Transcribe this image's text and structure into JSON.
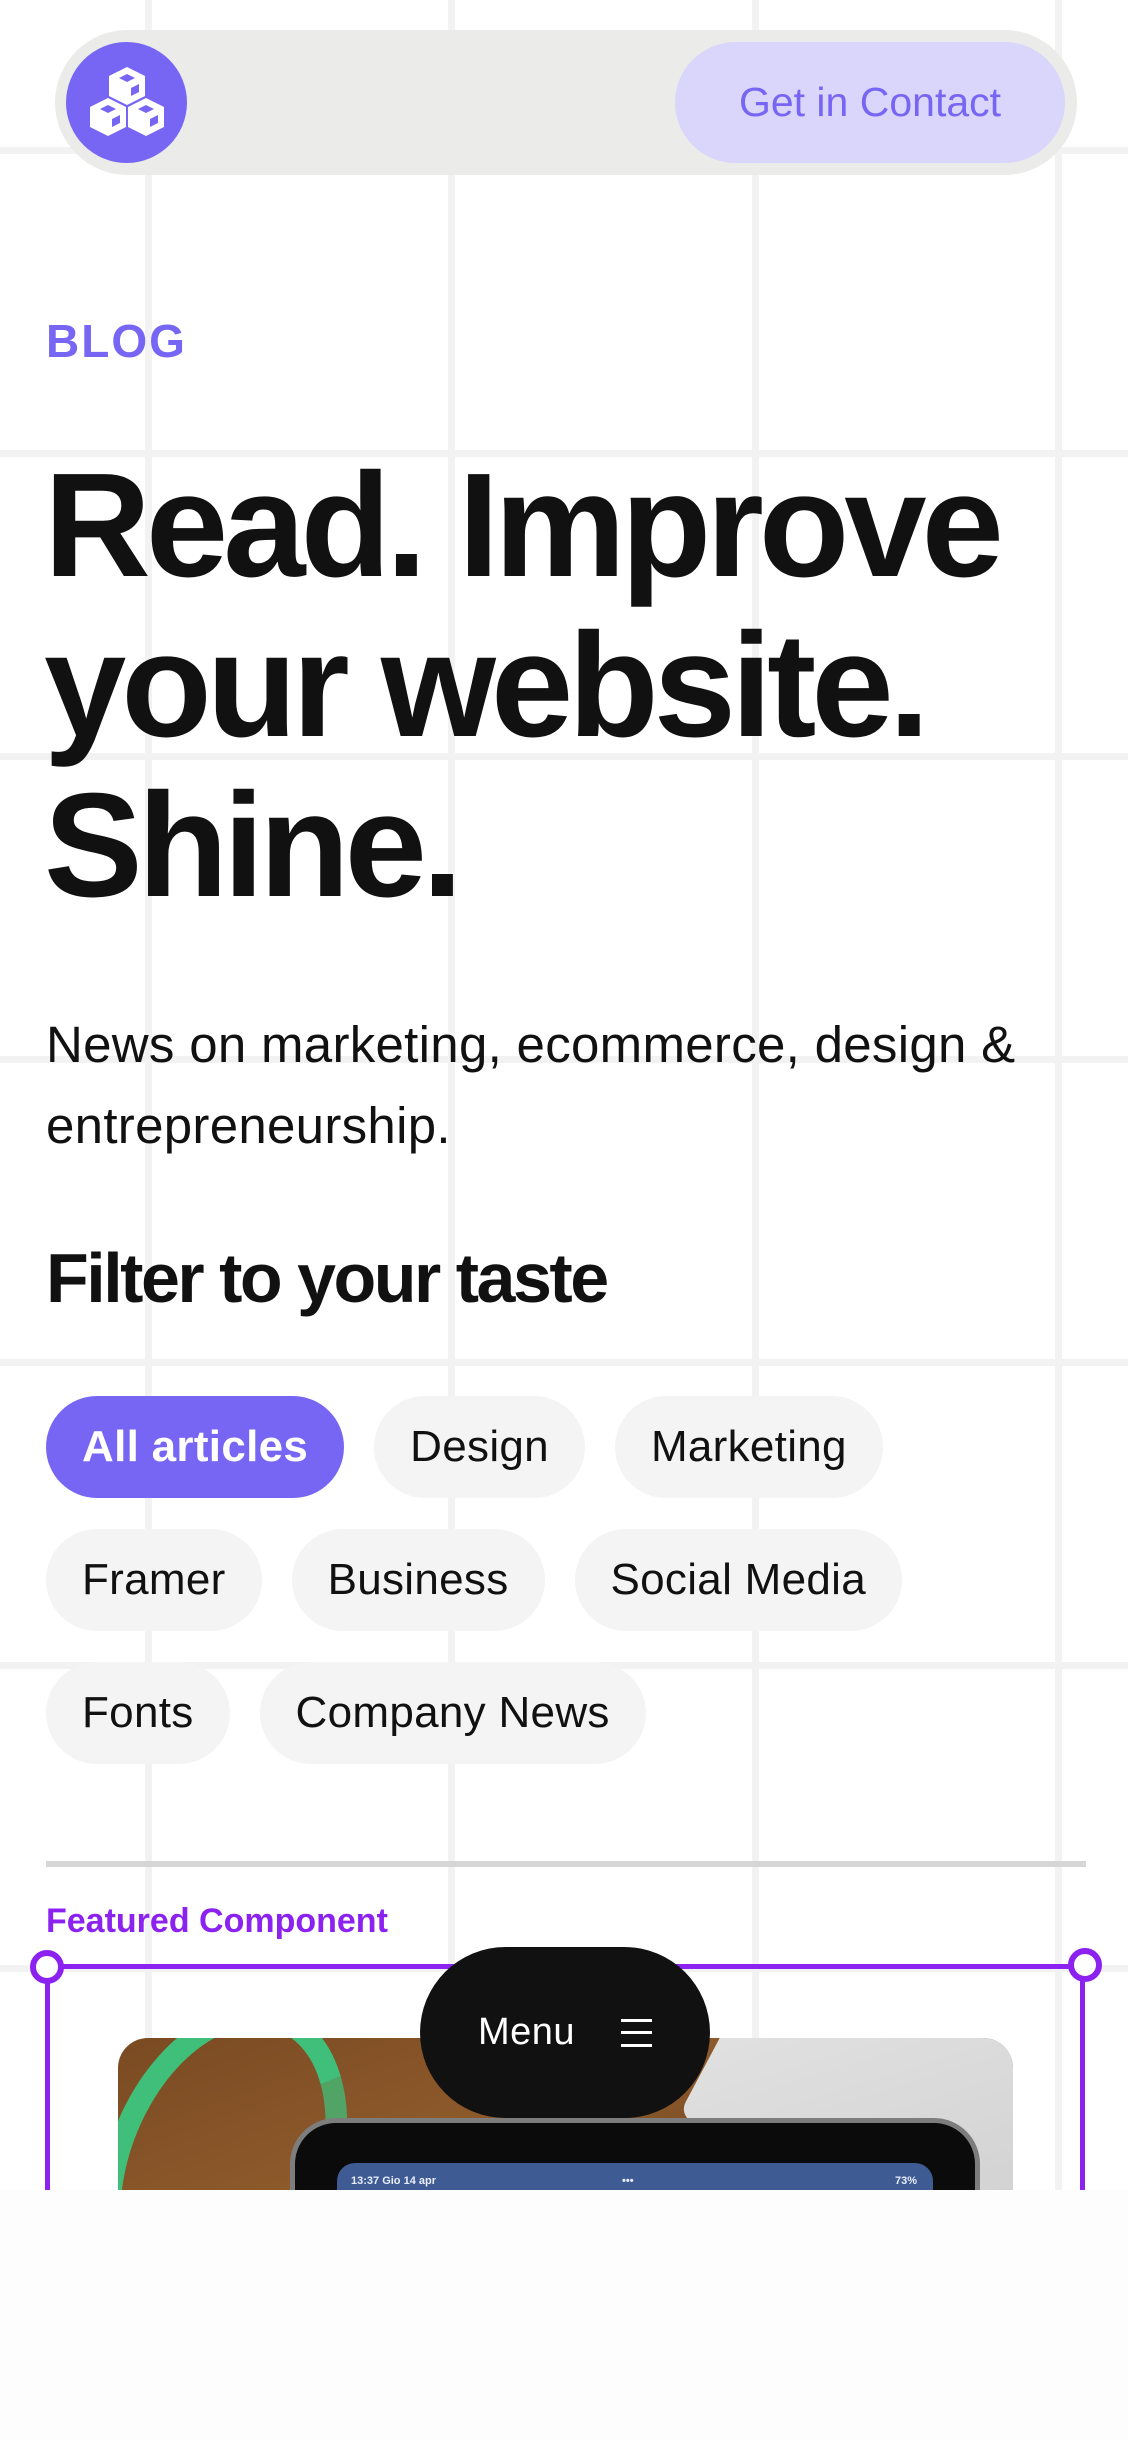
{
  "navbar": {
    "logo_icon": "cubes-icon",
    "contact_label": "Get in Contact"
  },
  "hero": {
    "eyebrow": "BLOG",
    "headline_lines": [
      "Read. Improve",
      "your website.",
      "Shine."
    ],
    "lead": "News on marketing, ecommerce, design & entrepreneurship."
  },
  "filters": {
    "title": "Filter to your taste",
    "chips": [
      {
        "label": "All articles",
        "active": true
      },
      {
        "label": "Design",
        "active": false
      },
      {
        "label": "Marketing",
        "active": false
      },
      {
        "label": "Framer",
        "active": false
      },
      {
        "label": "Business",
        "active": false
      },
      {
        "label": "Social Media",
        "active": false
      },
      {
        "label": "Fonts",
        "active": false
      },
      {
        "label": "Company News",
        "active": false
      }
    ]
  },
  "featured": {
    "label": "Featured Component",
    "image_status_left": "13:37  Gio 14 apr",
    "image_status_mid": "•••",
    "image_status_right": "73%"
  },
  "menu": {
    "label": "Menu",
    "icon": "hamburger-icon"
  },
  "colors": {
    "accent": "#7766f4",
    "accent_light": "#dad5fa",
    "selection": "#8b22f0",
    "text": "#111111",
    "chip_bg": "#f4f4f4",
    "navbar_bg": "#ebebea",
    "grid": "#f2f2f2"
  }
}
